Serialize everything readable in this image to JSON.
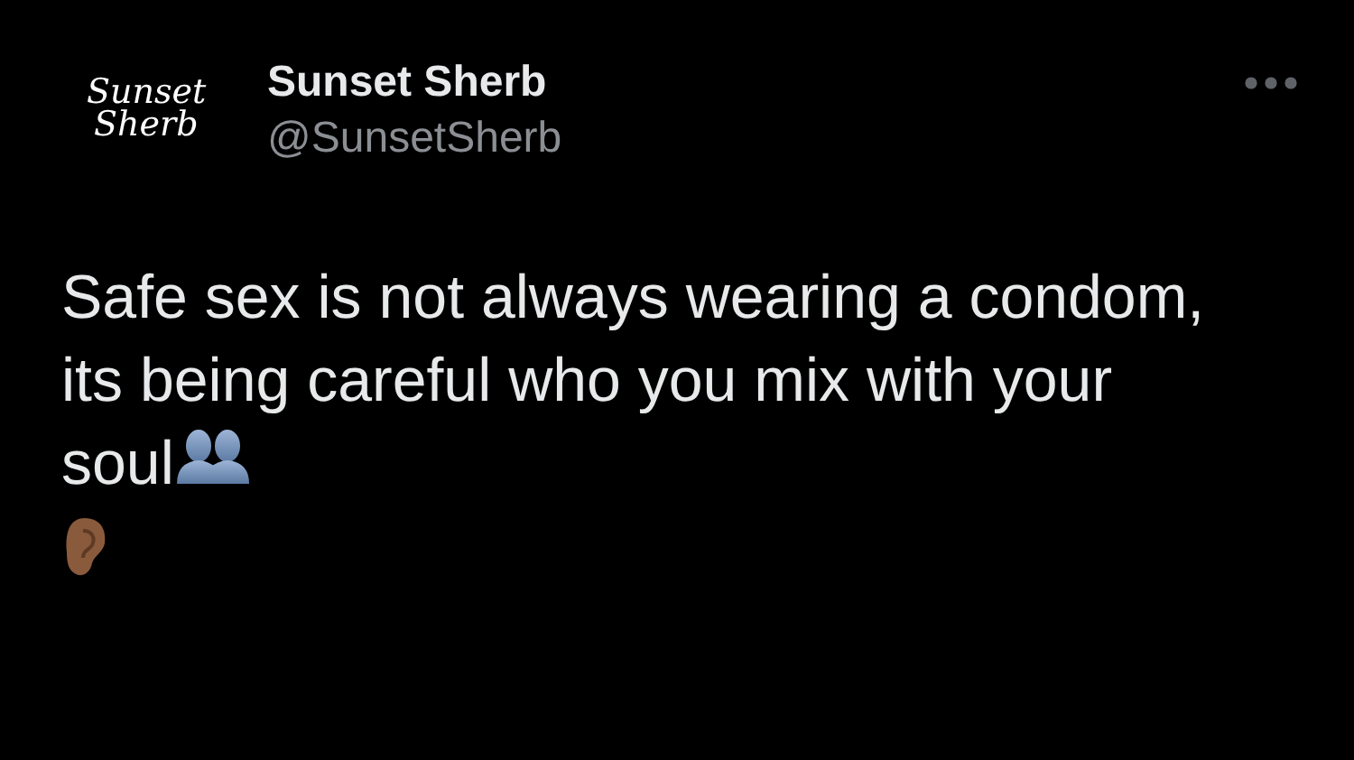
{
  "tweet": {
    "avatar_lines": [
      "Sunset",
      "Sherb"
    ],
    "name": "Sunset Sherb",
    "handle": "@SunsetSherb",
    "text": "Safe sex is not always wearing a condom, its being careful who you mix with your soul"
  }
}
